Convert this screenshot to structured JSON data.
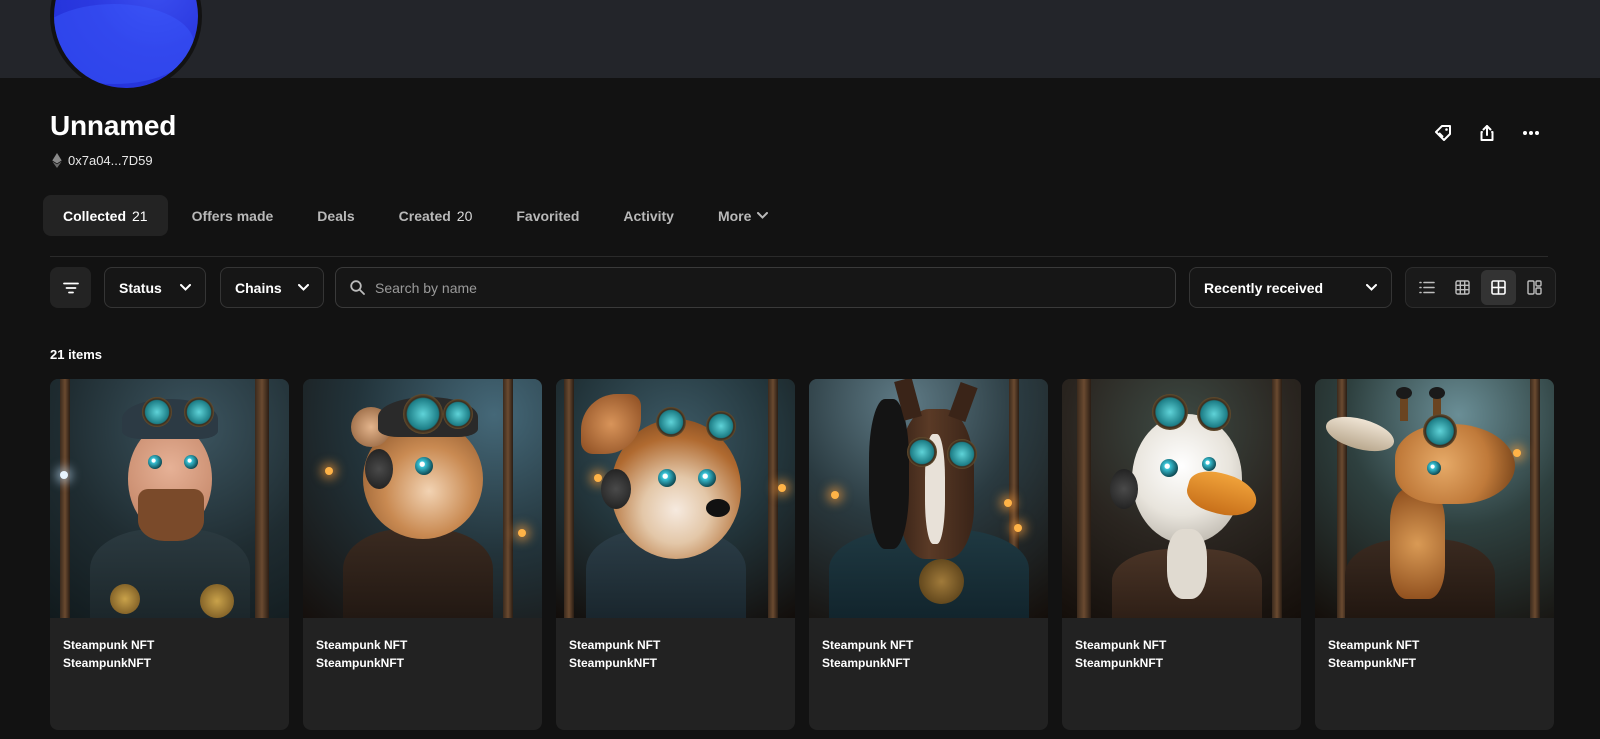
{
  "profile": {
    "name": "Unnamed",
    "address": "0x7a04...7D59",
    "avatar_color": "#2b39e0"
  },
  "actions": {
    "offer_icon": "tag-offer-icon",
    "share_icon": "share-icon",
    "more_icon": "more-horizontal-icon"
  },
  "tabs": [
    {
      "label": "Collected",
      "count": "21",
      "active": true
    },
    {
      "label": "Offers made",
      "count": ""
    },
    {
      "label": "Deals",
      "count": ""
    },
    {
      "label": "Created",
      "count": "20"
    },
    {
      "label": "Favorited",
      "count": ""
    },
    {
      "label": "Activity",
      "count": ""
    },
    {
      "label": "More",
      "count": ""
    }
  ],
  "toolbar": {
    "status_label": "Status",
    "chains_label": "Chains",
    "search_placeholder": "Search by name",
    "search_value": "",
    "sort_label": "Recently received",
    "view_modes": [
      "list-view-icon",
      "small-grid-icon",
      "large-grid-icon",
      "masonry-view-icon"
    ],
    "active_view": "large-grid-icon"
  },
  "items_count": "21 items",
  "cards": [
    {
      "name": "Steampunk NFT",
      "collection": "SteampunkNFT",
      "subject": "bearded man"
    },
    {
      "name": "Steampunk NFT",
      "collection": "SteampunkNFT",
      "subject": "ferret"
    },
    {
      "name": "Steampunk NFT",
      "collection": "SteampunkNFT",
      "subject": "puppy"
    },
    {
      "name": "Steampunk NFT",
      "collection": "SteampunkNFT",
      "subject": "horse"
    },
    {
      "name": "Steampunk NFT",
      "collection": "SteampunkNFT",
      "subject": "duck"
    },
    {
      "name": "Steampunk NFT",
      "collection": "SteampunkNFT",
      "subject": "giraffe"
    }
  ],
  "colors": {
    "background": "#121212",
    "banner": "#23252a",
    "card": "#222222",
    "tab_active": "#232323"
  }
}
